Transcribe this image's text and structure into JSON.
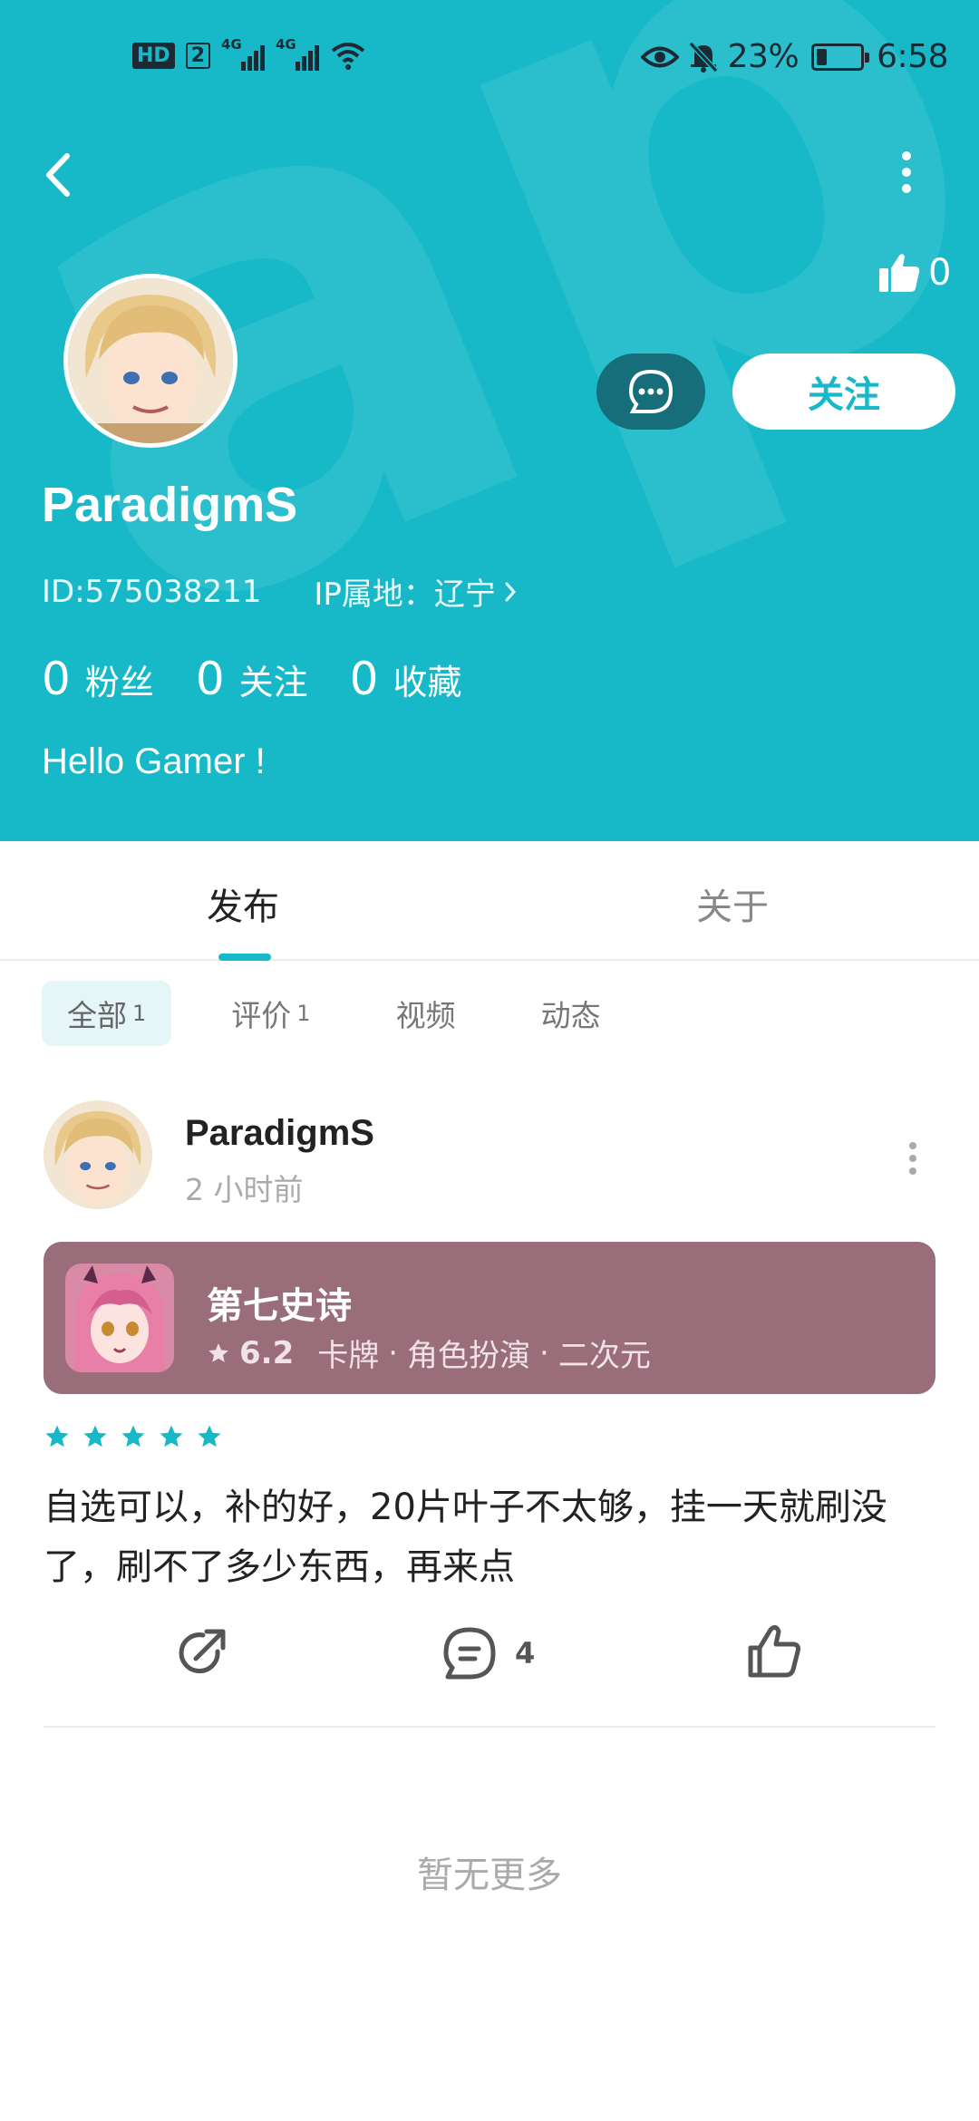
{
  "status_bar": {
    "hd": "HD",
    "sim": "2",
    "net1": "4G",
    "net2": "4G",
    "battery": "23%",
    "battery_level": 0.23,
    "time": "6:58"
  },
  "profile": {
    "like_count": "0",
    "username": "ParadigmS",
    "id_text": "ID:575038211",
    "ip_text": "IP属地：辽宁",
    "message_button_icon": "chat-bubble-icon",
    "follow_label": "关注",
    "stats": [
      {
        "num": "0",
        "label": "粉丝"
      },
      {
        "num": "0",
        "label": "关注"
      },
      {
        "num": "0",
        "label": "收藏"
      }
    ],
    "bio": "Hello Gamer !"
  },
  "tabs": [
    {
      "label": "发布",
      "active": true
    },
    {
      "label": "关于",
      "active": false
    }
  ],
  "filters": [
    {
      "label": "全部",
      "count": "1",
      "active": true
    },
    {
      "label": "评价",
      "count": "1",
      "active": false
    },
    {
      "label": "视频",
      "count": "",
      "active": false
    },
    {
      "label": "动态",
      "count": "",
      "active": false
    }
  ],
  "post": {
    "username": "ParadigmS",
    "time": "2 小时前",
    "game": {
      "name": "第七史诗",
      "score": "6.2",
      "tags": [
        "卡牌",
        "角色扮演",
        "二次元"
      ],
      "card_color": "#9a6d7b"
    },
    "rating": 5,
    "review": "自选可以，补的好，20片叶子不太够，挂一天就刷没了，刷不了多少东西，再来点",
    "comment_count": "4"
  },
  "footer": {
    "no_more": "暂无更多"
  },
  "colors": {
    "accent": "#17b9c8",
    "star": "#17b9c8"
  }
}
